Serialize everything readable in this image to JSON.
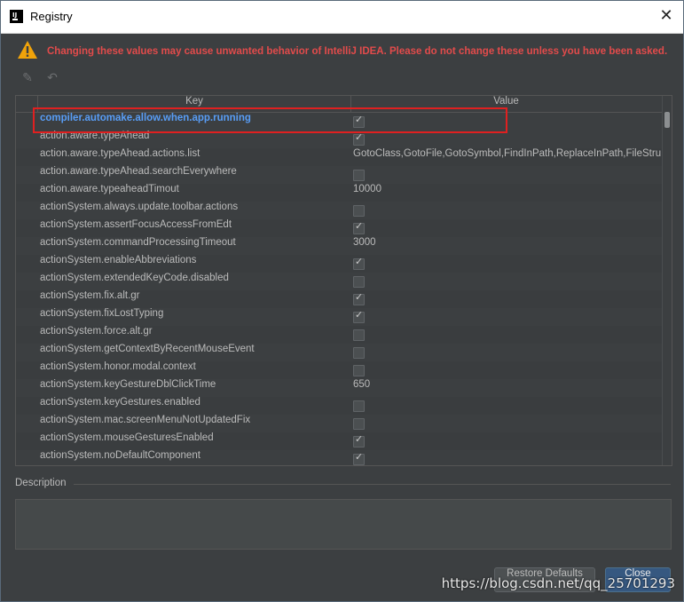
{
  "window": {
    "title": "Registry",
    "close_glyph": "✕"
  },
  "warning": {
    "icon": "warning-triangle-icon",
    "text": "Changing these values may cause unwanted behavior of IntelliJ IDEA. Please do not change these unless you have been asked."
  },
  "toolbar": {
    "edit_icon": "pencil-icon",
    "revert_icon": "undo-icon",
    "edit_glyph": "✎",
    "revert_glyph": "↶"
  },
  "table": {
    "headers": {
      "key": "Key",
      "value": "Value"
    },
    "rows": [
      {
        "key": "compiler.automake.allow.when.app.running",
        "type": "checkbox",
        "checked": true,
        "selected": true
      },
      {
        "key": "action.aware.typeAhead",
        "type": "checkbox",
        "checked": true
      },
      {
        "key": "action.aware.typeAhead.actions.list",
        "type": "text",
        "value": "GotoClass,GotoFile,GotoSymbol,FindInPath,ReplaceInPath,FileStru"
      },
      {
        "key": "action.aware.typeAhead.searchEverywhere",
        "type": "checkbox",
        "checked": false
      },
      {
        "key": "action.aware.typeaheadTimout",
        "type": "text",
        "value": "10000"
      },
      {
        "key": "actionSystem.always.update.toolbar.actions",
        "type": "checkbox",
        "checked": false
      },
      {
        "key": "actionSystem.assertFocusAccessFromEdt",
        "type": "checkbox",
        "checked": true
      },
      {
        "key": "actionSystem.commandProcessingTimeout",
        "type": "text",
        "value": "3000"
      },
      {
        "key": "actionSystem.enableAbbreviations",
        "type": "checkbox",
        "checked": true
      },
      {
        "key": "actionSystem.extendedKeyCode.disabled",
        "type": "checkbox",
        "checked": false
      },
      {
        "key": "actionSystem.fix.alt.gr",
        "type": "checkbox",
        "checked": true
      },
      {
        "key": "actionSystem.fixLostTyping",
        "type": "checkbox",
        "checked": true
      },
      {
        "key": "actionSystem.force.alt.gr",
        "type": "checkbox",
        "checked": false
      },
      {
        "key": "actionSystem.getContextByRecentMouseEvent",
        "type": "checkbox",
        "checked": false
      },
      {
        "key": "actionSystem.honor.modal.context",
        "type": "checkbox",
        "checked": false
      },
      {
        "key": "actionSystem.keyGestureDblClickTime",
        "type": "text",
        "value": "650"
      },
      {
        "key": "actionSystem.keyGestures.enabled",
        "type": "checkbox",
        "checked": false
      },
      {
        "key": "actionSystem.mac.screenMenuNotUpdatedFix",
        "type": "checkbox",
        "checked": false
      },
      {
        "key": "actionSystem.mouseGesturesEnabled",
        "type": "checkbox",
        "checked": true
      },
      {
        "key": "actionSystem.noDefaultComponent",
        "type": "checkbox",
        "checked": true
      }
    ]
  },
  "description": {
    "label": "Description",
    "value": ""
  },
  "buttons": {
    "restore": "Restore Defaults",
    "close": "Close"
  },
  "watermark": "https://blog.csdn.net/qq_25701293",
  "colors": {
    "warning_text": "#e24b4b",
    "selected_key": "#589df6",
    "highlight_box": "#e02020",
    "primary_button": "#365880"
  }
}
